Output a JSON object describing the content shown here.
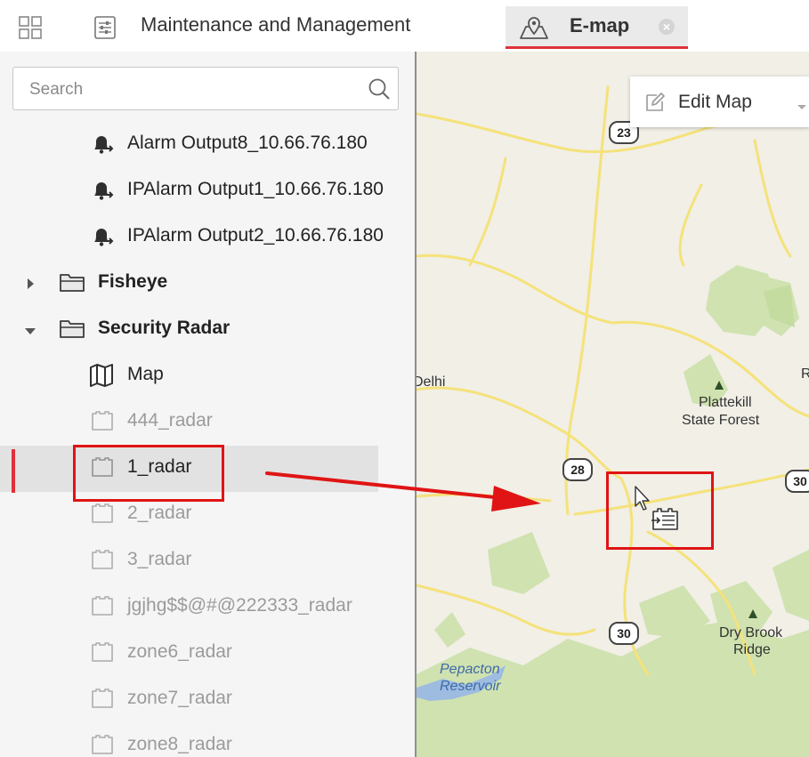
{
  "topbar": {
    "tabs": [
      {
        "label": "Maintenance and Management"
      },
      {
        "label": "E-map"
      }
    ]
  },
  "search": {
    "placeholder": "Search",
    "value": ""
  },
  "tree": {
    "items": [
      {
        "label": "Alarm Output8_10.66.76.180"
      },
      {
        "label": "IPAlarm Output1_10.66.76.180"
      },
      {
        "label": "IPAlarm Output2_10.66.76.180"
      },
      {
        "label": "Fisheye"
      },
      {
        "label": "Security Radar"
      },
      {
        "label": "Map"
      },
      {
        "label": "444_radar"
      },
      {
        "label": "1_radar"
      },
      {
        "label": "2_radar"
      },
      {
        "label": "3_radar"
      },
      {
        "label": "jgjhg$$@#@222333_radar"
      },
      {
        "label": "zone6_radar"
      },
      {
        "label": "zone7_radar"
      },
      {
        "label": "zone8_radar"
      }
    ]
  },
  "map": {
    "edit_label": "Edit Map",
    "places": [
      {
        "label": "Delhi"
      },
      {
        "label": "Plattekill"
      },
      {
        "label": "State Forest"
      },
      {
        "label": "Dry Brook"
      },
      {
        "label": "Ridge"
      },
      {
        "label": "Pepacton"
      },
      {
        "label": "Reservoir"
      },
      {
        "label": "R"
      }
    ],
    "routes": [
      {
        "label": "23"
      },
      {
        "label": "28"
      },
      {
        "label": "30"
      },
      {
        "label": "30"
      }
    ]
  },
  "colors": {
    "accent": "#e0313a",
    "highlight_box": "#e01414",
    "road": "#f5e27a",
    "forest": "#cfe2b0",
    "water": "#9dbce0"
  }
}
